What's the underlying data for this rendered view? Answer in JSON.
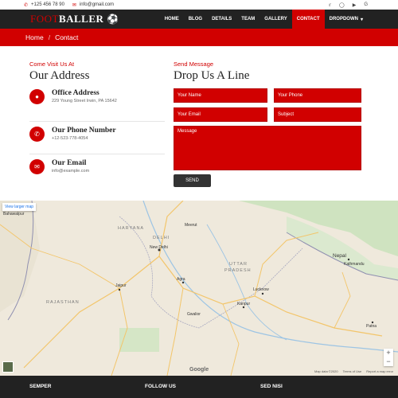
{
  "topbar": {
    "phone": "+125 456 78 90",
    "email": "info@gmail.com",
    "socials": [
      "twitter-icon",
      "instagram-icon",
      "youtube-icon",
      "google-icon"
    ]
  },
  "nav": {
    "logo_red": "FOOT",
    "logo_white": "BALLER",
    "items": [
      "HOME",
      "BLOG",
      "DETAILS",
      "TEAM",
      "GALLERY",
      "CONTACT",
      "DROPDOWN"
    ],
    "active": "CONTACT",
    "colors": {
      "accent": "#d10000",
      "nav_bg": "#222222"
    }
  },
  "breadcrumb": {
    "home": "Home",
    "sep": "/",
    "current": "Contact"
  },
  "address": {
    "eyebrow": "Come Visit Us At",
    "heading": "Our Address",
    "items": [
      {
        "icon": "location-pin-icon",
        "title": "Office Address",
        "value": "229 Young Street Irwin, PA 15642"
      },
      {
        "icon": "phone-icon",
        "title": "Our Phone Number",
        "value": "+12-523-778-4054"
      },
      {
        "icon": "email-icon",
        "title": "Our Email",
        "value": "info@example.com"
      }
    ]
  },
  "contact_form": {
    "eyebrow": "Send Message",
    "heading": "Drop Us A Line",
    "name_placeholder": "Your Name",
    "phone_placeholder": "Your Phone",
    "email_placeholder": "Your Email",
    "subject_placeholder": "Subject",
    "message_placeholder": "Message",
    "send_label": "SEND"
  },
  "map": {
    "view_larger": "View larger map",
    "labels": {
      "haryana": "HARYANA",
      "delhi": "DELHI",
      "new_delhi": "New Delhi",
      "uttar_pradesh_1": "UTTAR",
      "uttar_pradesh_2": "PRADESH",
      "rajasthan": "RAJASTHAN",
      "nepal": "Nepal",
      "agra": "Agra",
      "lucknow": "Lucknow",
      "kanpur": "Kanpur",
      "jaipur": "Jaipur",
      "kathmandu": "Kathmandu",
      "bahawalpur": "Bahawalpur",
      "gwalior": "Gwalior",
      "patna": "Patna",
      "meerut": "Meerut"
    },
    "google": "Google",
    "map_data": "Map data ©2020",
    "terms": "Terms of Use",
    "report": "Report a map error"
  },
  "footer": {
    "cols": [
      "SEMPER",
      "FOLLOW US",
      "SED NISI"
    ]
  }
}
